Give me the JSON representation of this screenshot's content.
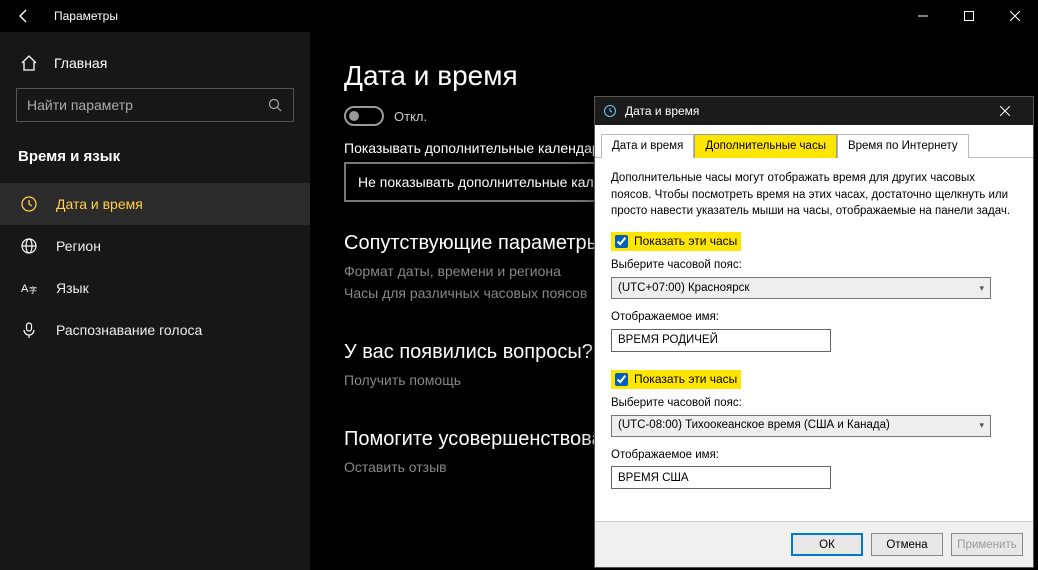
{
  "window": {
    "app_title": "Параметры"
  },
  "sidebar": {
    "home": "Главная",
    "search_placeholder": "Найти параметр",
    "category": "Время и язык",
    "items": [
      {
        "label": "Дата и время"
      },
      {
        "label": "Регион"
      },
      {
        "label": "Язык"
      },
      {
        "label": "Распознавание голоса"
      }
    ]
  },
  "main": {
    "heading": "Дата и время",
    "toggle_state": "Откл.",
    "calendars_label": "Показывать дополнительные календари на панели задач",
    "calendars_value": "Не показывать дополнительные календари",
    "related_heading": "Сопутствующие параметры",
    "related_link1": "Формат даты, времени и региона",
    "related_link2": "Часы для различных часовых поясов",
    "questions_heading": "У вас появились вопросы?",
    "questions_link": "Получить помощь",
    "improve_heading": "Помогите усовершенствовать",
    "improve_link": "Оставить отзыв"
  },
  "dialog": {
    "title": "Дата и время",
    "tabs": {
      "t1": "Дата и время",
      "t2": "Дополнительные часы",
      "t3": "Время по Интернету"
    },
    "description": "Дополнительные часы могут отображать время для других часовых поясов. Чтобы посмотреть время на этих часах, достаточно щелкнуть или просто навести указатель мыши на часы, отображаемые на панели задач.",
    "labels": {
      "show": "Показать эти часы",
      "tz": "Выберите часовой пояс:",
      "name": "Отображаемое имя:"
    },
    "clock1": {
      "tz": "(UTC+07:00) Красноярск",
      "name": "ВРЕМЯ РОДИЧЕЙ"
    },
    "clock2": {
      "tz": "(UTC-08:00) Тихоокеанское время (США и Канада)",
      "name": "ВРЕМЯ США"
    },
    "buttons": {
      "ok": "ОК",
      "cancel": "Отмена",
      "apply": "Применить"
    }
  }
}
